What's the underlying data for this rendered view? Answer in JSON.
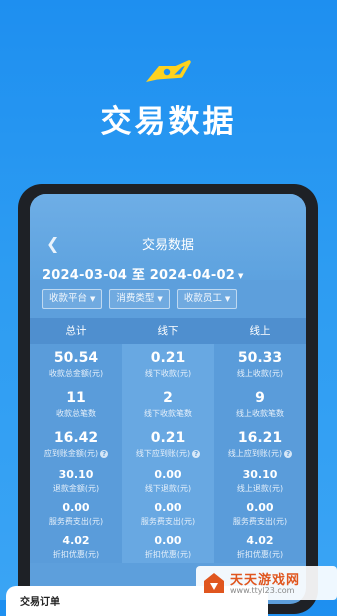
{
  "headline": "交易数据",
  "app": {
    "title": "交易数据",
    "back_icon": "chevron-left-icon",
    "date_range": "2024-03-04 至 2024-04-02",
    "filters": [
      "收款平台",
      "消费类型",
      "收款员工"
    ],
    "columns": [
      "总计",
      "线下",
      "线上"
    ],
    "rows": [
      [
        {
          "v": "50.54",
          "l": "收款总金额(元)"
        },
        {
          "v": "0.21",
          "l": "线下收款(元)"
        },
        {
          "v": "50.33",
          "l": "线上收款(元)"
        }
      ],
      [
        {
          "v": "11",
          "l": "收款总笔数"
        },
        {
          "v": "2",
          "l": "线下收款笔数"
        },
        {
          "v": "9",
          "l": "线上收款笔数"
        }
      ],
      [
        {
          "v": "16.42",
          "l": "应到账金额(元)"
        },
        {
          "v": "0.21",
          "l": "线下应到账(元)"
        },
        {
          "v": "16.21",
          "l": "线上应到账(元)"
        }
      ],
      [
        {
          "v": "30.10",
          "l": "退款金额(元)"
        },
        {
          "v": "0.00",
          "l": "线下退款(元)"
        },
        {
          "v": "30.10",
          "l": "线上退款(元)"
        }
      ],
      [
        {
          "v": "0.00",
          "l": "服务费支出(元)"
        },
        {
          "v": "0.00",
          "l": "服务费支出(元)"
        },
        {
          "v": "0.00",
          "l": "服务费支出(元)"
        }
      ],
      [
        {
          "v": "4.02",
          "l": "折扣优惠(元)"
        },
        {
          "v": "0.00",
          "l": "折扣优惠(元)"
        },
        {
          "v": "4.02",
          "l": "折扣优惠(元)"
        }
      ]
    ],
    "sheet_title": "交易订单"
  },
  "watermark": {
    "name": "天天游戏网",
    "url": "www.ttyl23.com"
  },
  "colors": {
    "background": "#1e8ff0",
    "accent": "#ffd21e"
  }
}
